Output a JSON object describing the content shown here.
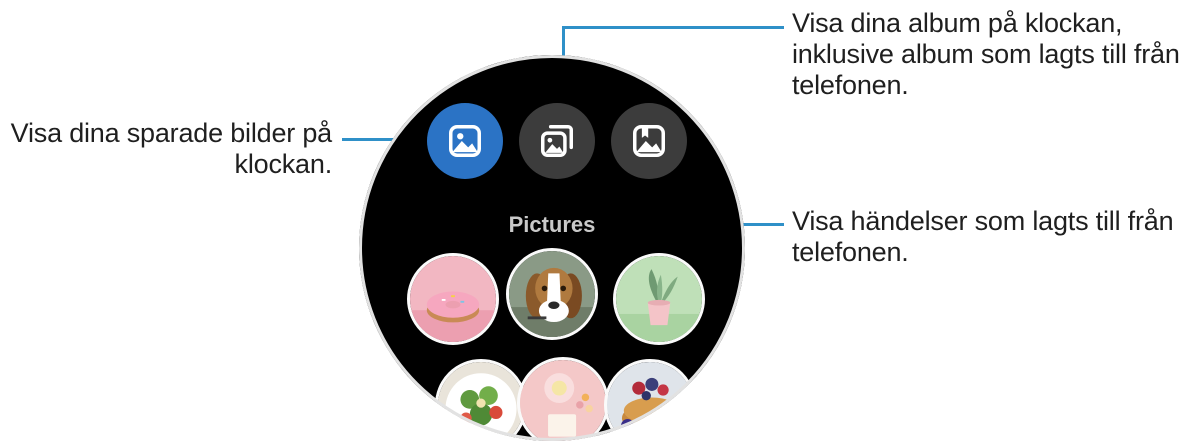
{
  "callouts": {
    "saved_pictures": [
      "Visa dina sparade bilder på",
      "klockan."
    ],
    "albums": [
      "Visa dina album på klockan,",
      "inklusive album som lagts till från",
      "telefonen."
    ],
    "stories": [
      "Visa händelser som lagts till från",
      "telefonen."
    ]
  },
  "watch": {
    "section_title": "Pictures",
    "tabs": [
      {
        "icon": "picture-icon",
        "active": true
      },
      {
        "icon": "albums-icon",
        "active": false
      },
      {
        "icon": "stories-icon",
        "active": false
      }
    ],
    "thumbnails": [
      "donut-photo",
      "beagle-photo",
      "plant-photo",
      "salad-photo",
      "table-photo",
      "pancakes-photo"
    ]
  },
  "colors": {
    "accent": "#2b73c5",
    "leader_line": "#2f90c8",
    "tab_inactive": "#3c3c3c"
  }
}
